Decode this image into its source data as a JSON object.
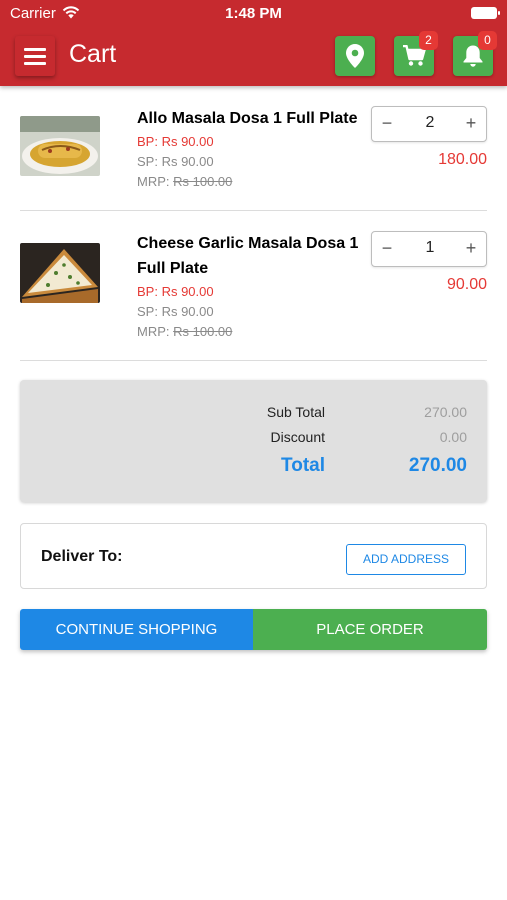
{
  "status_bar": {
    "carrier": "Carrier",
    "time": "1:48 PM"
  },
  "app_bar": {
    "title": "Cart",
    "cart_badge": "2",
    "notification_badge": "0",
    "colors": {
      "bar": "#c62a2f",
      "action": "#4caf50",
      "badge": "#e53935"
    }
  },
  "cart": {
    "items": [
      {
        "name": "Allo Masala Dosa 1 Full Plate",
        "bp": "BP: Rs 90.00",
        "sp": "SP: Rs 90.00",
        "mrp_label": "MRP: ",
        "mrp_value": "Rs 100.00",
        "qty": "2",
        "minus": "−",
        "plus": "+",
        "line_total": "180.00"
      },
      {
        "name": "Cheese Garlic Masala Dosa 1 Full Plate",
        "bp": "BP: Rs 90.00",
        "sp": "SP: Rs 90.00",
        "mrp_label": "MRP: ",
        "mrp_value": "Rs 100.00",
        "qty": "1",
        "minus": "−",
        "plus": "+",
        "line_total": "90.00"
      }
    ]
  },
  "summary": {
    "subtotal_label": "Sub Total",
    "subtotal_value": "270.00",
    "discount_label": "Discount",
    "discount_value": "0.00",
    "total_label": "Total",
    "total_value": "270.00"
  },
  "delivery": {
    "label": "Deliver To:",
    "add_address": "ADD ADDRESS"
  },
  "actions": {
    "continue": "CONTINUE SHOPPING",
    "place_order": "PLACE ORDER"
  },
  "icons": [
    "menu-icon",
    "map-marker-icon",
    "cart-icon",
    "bell-icon",
    "wifi-icon",
    "battery-icon"
  ]
}
